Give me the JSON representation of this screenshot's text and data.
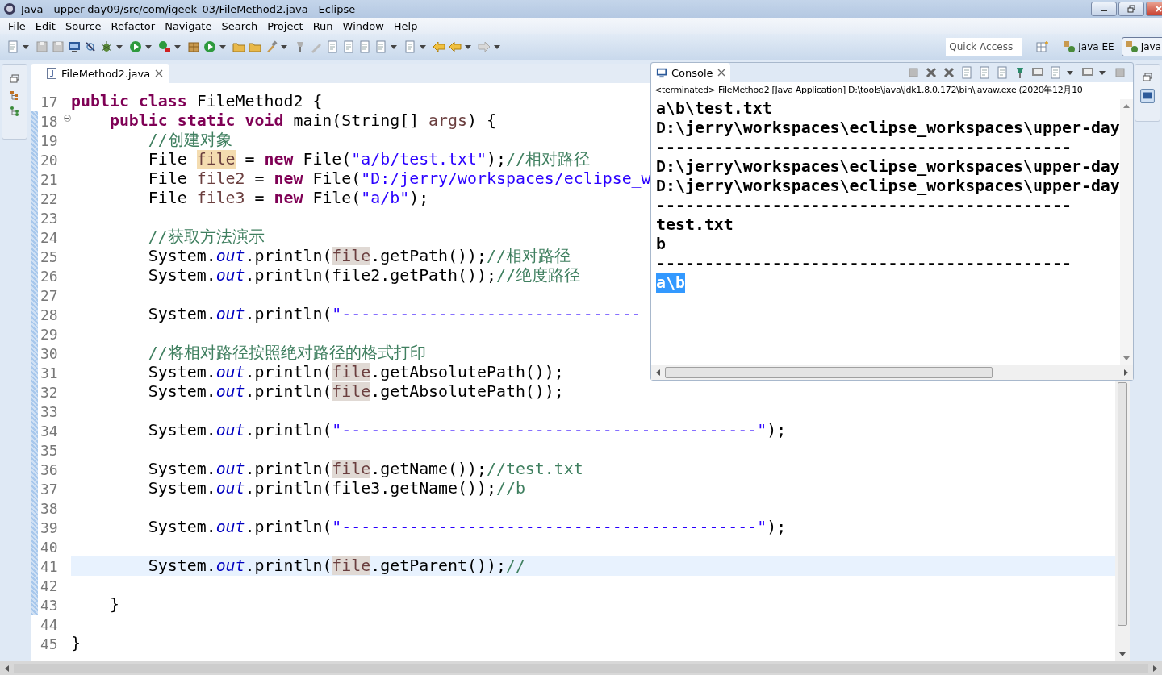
{
  "window": {
    "title": "Java - upper-day09/src/com/igeek_03/FileMethod2.java - Eclipse"
  },
  "menu": [
    "File",
    "Edit",
    "Source",
    "Refactor",
    "Navigate",
    "Search",
    "Project",
    "Run",
    "Window",
    "Help"
  ],
  "quick_access": {
    "placeholder": "Quick Access"
  },
  "perspectives": [
    {
      "label": "Java EE",
      "selected": false
    },
    {
      "label": "Java",
      "selected": true
    }
  ],
  "editor": {
    "tab": {
      "label": "FileMethod2.java"
    },
    "lines": [
      {
        "number": "17",
        "current": false,
        "tokens": [
          {
            "kind": "keyword",
            "text": "public class "
          },
          {
            "kind": "plain",
            "text": "FileMethod2 {"
          }
        ]
      },
      {
        "number": "18",
        "current": false,
        "foldable": true,
        "tokens": [
          {
            "kind": "keyword",
            "text": "    public static void "
          },
          {
            "kind": "plain",
            "text": "main(String[] "
          },
          {
            "kind": "local",
            "text": "args"
          },
          {
            "kind": "plain",
            "text": ") {"
          }
        ]
      },
      {
        "number": "19",
        "current": false,
        "tokens": [
          {
            "kind": "comment",
            "text": "        //创建对象"
          }
        ]
      },
      {
        "number": "20",
        "current": false,
        "tokens": [
          {
            "kind": "plain",
            "text": "        File "
          },
          {
            "kind": "occurrence-write",
            "text": "file"
          },
          {
            "kind": "plain",
            "text": " = "
          },
          {
            "kind": "keyword",
            "text": "new "
          },
          {
            "kind": "plain",
            "text": "File("
          },
          {
            "kind": "string",
            "text": "\"a/b/test.txt\""
          },
          {
            "kind": "plain",
            "text": ");"
          },
          {
            "kind": "comment",
            "text": "//相对路径"
          }
        ]
      },
      {
        "number": "21",
        "current": false,
        "tokens": [
          {
            "kind": "plain",
            "text": "        File "
          },
          {
            "kind": "local",
            "text": "file2"
          },
          {
            "kind": "plain",
            "text": " = "
          },
          {
            "kind": "keyword",
            "text": "new "
          },
          {
            "kind": "plain",
            "text": "File("
          },
          {
            "kind": "string",
            "text": "\"D:/jerry/workspaces/eclipse_w"
          }
        ]
      },
      {
        "number": "22",
        "current": false,
        "tokens": [
          {
            "kind": "plain",
            "text": "        File "
          },
          {
            "kind": "local",
            "text": "file3"
          },
          {
            "kind": "plain",
            "text": " = "
          },
          {
            "kind": "keyword",
            "text": "new "
          },
          {
            "kind": "plain",
            "text": "File("
          },
          {
            "kind": "string",
            "text": "\"a/b\""
          },
          {
            "kind": "plain",
            "text": ");"
          }
        ]
      },
      {
        "number": "23",
        "current": false
      },
      {
        "number": "24",
        "current": false,
        "tokens": [
          {
            "kind": "comment",
            "text": "        //获取方法演示"
          }
        ]
      },
      {
        "number": "25",
        "current": false,
        "tokens": [
          {
            "kind": "plain",
            "text": "        System."
          },
          {
            "kind": "static",
            "text": "out"
          },
          {
            "kind": "plain",
            "text": ".println("
          },
          {
            "kind": "occurrence-read",
            "text": "file"
          },
          {
            "kind": "plain",
            "text": ".getPath());"
          },
          {
            "kind": "comment",
            "text": "//相对路径"
          }
        ]
      },
      {
        "number": "26",
        "current": false,
        "tokens": [
          {
            "kind": "plain",
            "text": "        System."
          },
          {
            "kind": "static",
            "text": "out"
          },
          {
            "kind": "plain",
            "text": ".println(file2.getPath());"
          },
          {
            "kind": "comment",
            "text": "//绝度路径"
          }
        ]
      },
      {
        "number": "27",
        "current": false
      },
      {
        "number": "28",
        "current": false,
        "tokens": [
          {
            "kind": "plain",
            "text": "        System."
          },
          {
            "kind": "static",
            "text": "out"
          },
          {
            "kind": "plain",
            "text": ".println("
          },
          {
            "kind": "string",
            "text": "\"-------------------------------"
          }
        ]
      },
      {
        "number": "29",
        "current": false
      },
      {
        "number": "30",
        "current": false,
        "tokens": [
          {
            "kind": "comment",
            "text": "        //将相对路径按照绝对路径的格式打印"
          }
        ]
      },
      {
        "number": "31",
        "current": false,
        "tokens": [
          {
            "kind": "plain",
            "text": "        System."
          },
          {
            "kind": "static",
            "text": "out"
          },
          {
            "kind": "plain",
            "text": ".println("
          },
          {
            "kind": "occurrence-read",
            "text": "file"
          },
          {
            "kind": "plain",
            "text": ".getAbsolutePath());"
          }
        ]
      },
      {
        "number": "32",
        "current": false,
        "tokens": [
          {
            "kind": "plain",
            "text": "        System."
          },
          {
            "kind": "static",
            "text": "out"
          },
          {
            "kind": "plain",
            "text": ".println("
          },
          {
            "kind": "occurrence-read",
            "text": "file"
          },
          {
            "kind": "plain",
            "text": ".getAbsolutePath());"
          }
        ]
      },
      {
        "number": "33",
        "current": false
      },
      {
        "number": "34",
        "current": false,
        "tokens": [
          {
            "kind": "plain",
            "text": "        System."
          },
          {
            "kind": "static",
            "text": "out"
          },
          {
            "kind": "plain",
            "text": ".println("
          },
          {
            "kind": "string",
            "text": "\"-------------------------------------------\""
          },
          {
            "kind": "plain",
            "text": ");"
          }
        ]
      },
      {
        "number": "35",
        "current": false
      },
      {
        "number": "36",
        "current": false,
        "tokens": [
          {
            "kind": "plain",
            "text": "        System."
          },
          {
            "kind": "static",
            "text": "out"
          },
          {
            "kind": "plain",
            "text": ".println("
          },
          {
            "kind": "occurrence-read",
            "text": "file"
          },
          {
            "kind": "plain",
            "text": ".getName());"
          },
          {
            "kind": "comment",
            "text": "//test.txt"
          }
        ]
      },
      {
        "number": "37",
        "current": false,
        "tokens": [
          {
            "kind": "plain",
            "text": "        System."
          },
          {
            "kind": "static",
            "text": "out"
          },
          {
            "kind": "plain",
            "text": ".println(file3.getName());"
          },
          {
            "kind": "comment",
            "text": "//b"
          }
        ]
      },
      {
        "number": "38",
        "current": false
      },
      {
        "number": "39",
        "current": false,
        "tokens": [
          {
            "kind": "plain",
            "text": "        System."
          },
          {
            "kind": "static",
            "text": "out"
          },
          {
            "kind": "plain",
            "text": ".println("
          },
          {
            "kind": "string",
            "text": "\"-------------------------------------------\""
          },
          {
            "kind": "plain",
            "text": ");"
          }
        ]
      },
      {
        "number": "40",
        "current": false
      },
      {
        "number": "41",
        "current": true,
        "tokens": [
          {
            "kind": "plain",
            "text": "        System."
          },
          {
            "kind": "static",
            "text": "out"
          },
          {
            "kind": "plain",
            "text": ".println("
          },
          {
            "kind": "occurrence-read",
            "text": "file"
          },
          {
            "kind": "plain",
            "text": ".getParent());"
          },
          {
            "kind": "comment",
            "text": "//"
          }
        ]
      },
      {
        "number": "42",
        "current": false
      },
      {
        "number": "43",
        "current": false,
        "tokens": [
          {
            "kind": "plain",
            "text": "    }"
          }
        ]
      },
      {
        "number": "44",
        "current": false
      },
      {
        "number": "45",
        "current": false,
        "tokens": [
          {
            "kind": "plain",
            "text": "}"
          }
        ]
      }
    ]
  },
  "console": {
    "tab": {
      "label": "Console"
    },
    "status": "<terminated> FileMethod2 [Java Application] D:\\tools\\java\\jdk1.8.0.172\\bin\\javaw.exe (2020年12月10",
    "output": [
      {
        "text": "a\\b\\test.txt",
        "selected": false
      },
      {
        "text": "D:\\jerry\\workspaces\\eclipse_workspaces\\upper-day",
        "selected": false
      },
      {
        "text": "-------------------------------------------",
        "selected": false
      },
      {
        "text": "D:\\jerry\\workspaces\\eclipse_workspaces\\upper-day",
        "selected": false
      },
      {
        "text": "D:\\jerry\\workspaces\\eclipse_workspaces\\upper-day",
        "selected": false
      },
      {
        "text": "-------------------------------------------",
        "selected": false
      },
      {
        "text": "test.txt",
        "selected": false
      },
      {
        "text": "b",
        "selected": false
      },
      {
        "text": "-------------------------------------------",
        "selected": false
      },
      {
        "text": "a\\b",
        "selected": true
      }
    ]
  }
}
